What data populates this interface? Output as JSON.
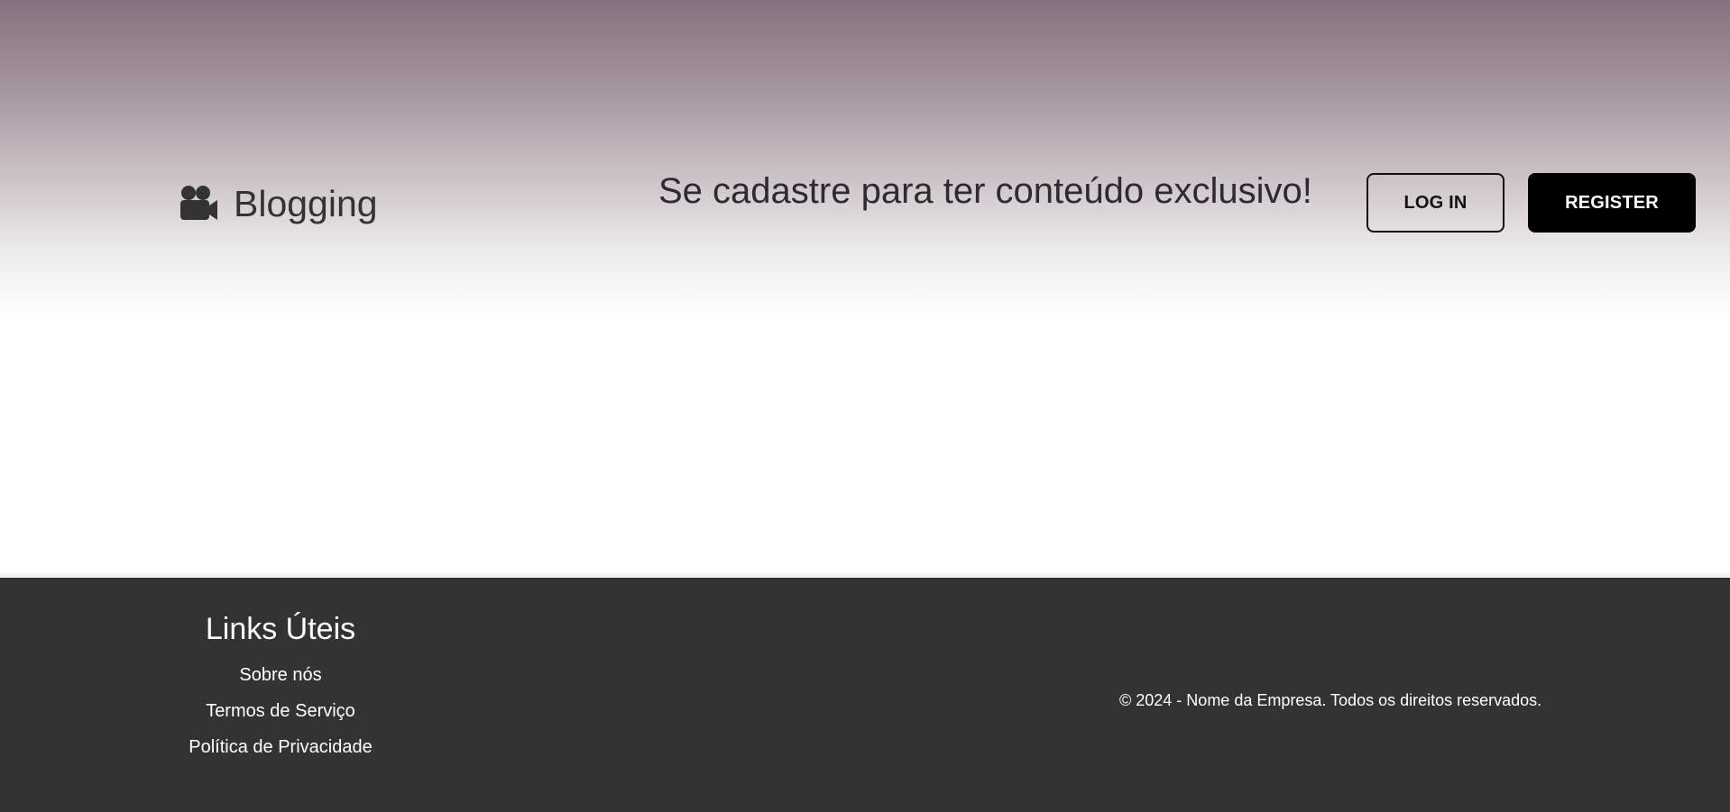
{
  "header": {
    "brand_name": "Blogging",
    "brand_icon": "video-camera-icon",
    "tagline": "Se cadastre para ter conteúdo exclusivo!",
    "login_label": "LOG IN",
    "register_label": "REGISTER"
  },
  "footer": {
    "links_title": "Links Úteis",
    "links": [
      {
        "label": "Sobre nós"
      },
      {
        "label": "Termos de Serviço"
      },
      {
        "label": "Política de Privacidade"
      }
    ],
    "copyright": "© 2024 - Nome da Empresa. Todos os direitos reservados."
  },
  "colors": {
    "hero_top": "#85717f",
    "footer_bg": "#333333",
    "register_bg": "#000000",
    "text_dark": "#333333"
  }
}
